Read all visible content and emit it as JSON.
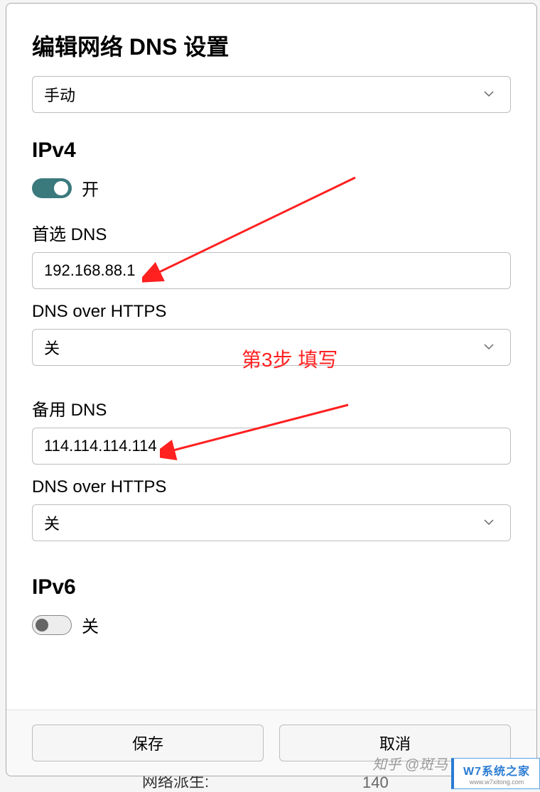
{
  "dialog": {
    "title": "编辑网络 DNS 设置",
    "mode_select": "手动"
  },
  "ipv4": {
    "heading": "IPv4",
    "toggle_on": true,
    "toggle_label": "开",
    "primary_dns_label": "首选 DNS",
    "primary_dns_value": "192.168.88.1",
    "doh_label_1": "DNS over HTTPS",
    "doh_value_1": "关",
    "alt_dns_label": "备用 DNS",
    "alt_dns_value": "114.114.114.114",
    "doh_label_2": "DNS over HTTPS",
    "doh_value_2": "关"
  },
  "ipv6": {
    "heading": "IPv6",
    "toggle_on": false,
    "toggle_label": "关"
  },
  "footer": {
    "save": "保存",
    "cancel": "取消"
  },
  "annotations": {
    "step3": "第3步 填写",
    "zhihu": "知乎 @斑马",
    "watermark_main": "W7系统之家",
    "watermark_sub": "www.w7xitong.com"
  },
  "background": {
    "fragment1": "网络派生:",
    "fragment2": "140"
  },
  "colors": {
    "toggle_on": "#3a7a7d",
    "annotation": "#ff2020"
  }
}
